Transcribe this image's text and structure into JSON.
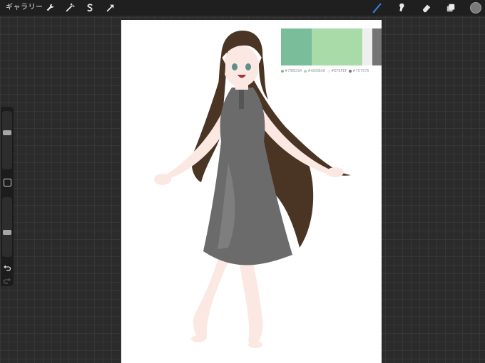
{
  "topbar": {
    "gallery_label": "ギャラリー",
    "left_tools": [
      "wrench-icon",
      "magic-wand-icon",
      "selection-icon",
      "transform-arrow-icon"
    ],
    "right_tools": [
      "brush-icon",
      "smudge-icon",
      "eraser-icon",
      "layers-icon"
    ],
    "active_tool": "brush-icon",
    "active_color": "#7a7a7a",
    "brush_accent": "#3b82f6"
  },
  "sidebar": {
    "brush_size_level": 0.4,
    "opacity_level": 0.6,
    "icons": [
      "modify-square-icon",
      "undo-icon",
      "redo-icon"
    ]
  },
  "palette": {
    "swatches": [
      {
        "hex": "#79BD9A",
        "label": "#79BD9A"
      },
      {
        "hex": "#A8DBA8",
        "label": "#A8DBA8"
      },
      {
        "hex": "#EFEFEF",
        "label": "#EFEFEF"
      },
      {
        "hex": "#757575",
        "label": "#757575"
      }
    ]
  },
  "colors": {
    "hair": "#4a3524",
    "dress": "#6b6b6b",
    "skin": "#fce8e2",
    "canvas": "#ffffff"
  }
}
